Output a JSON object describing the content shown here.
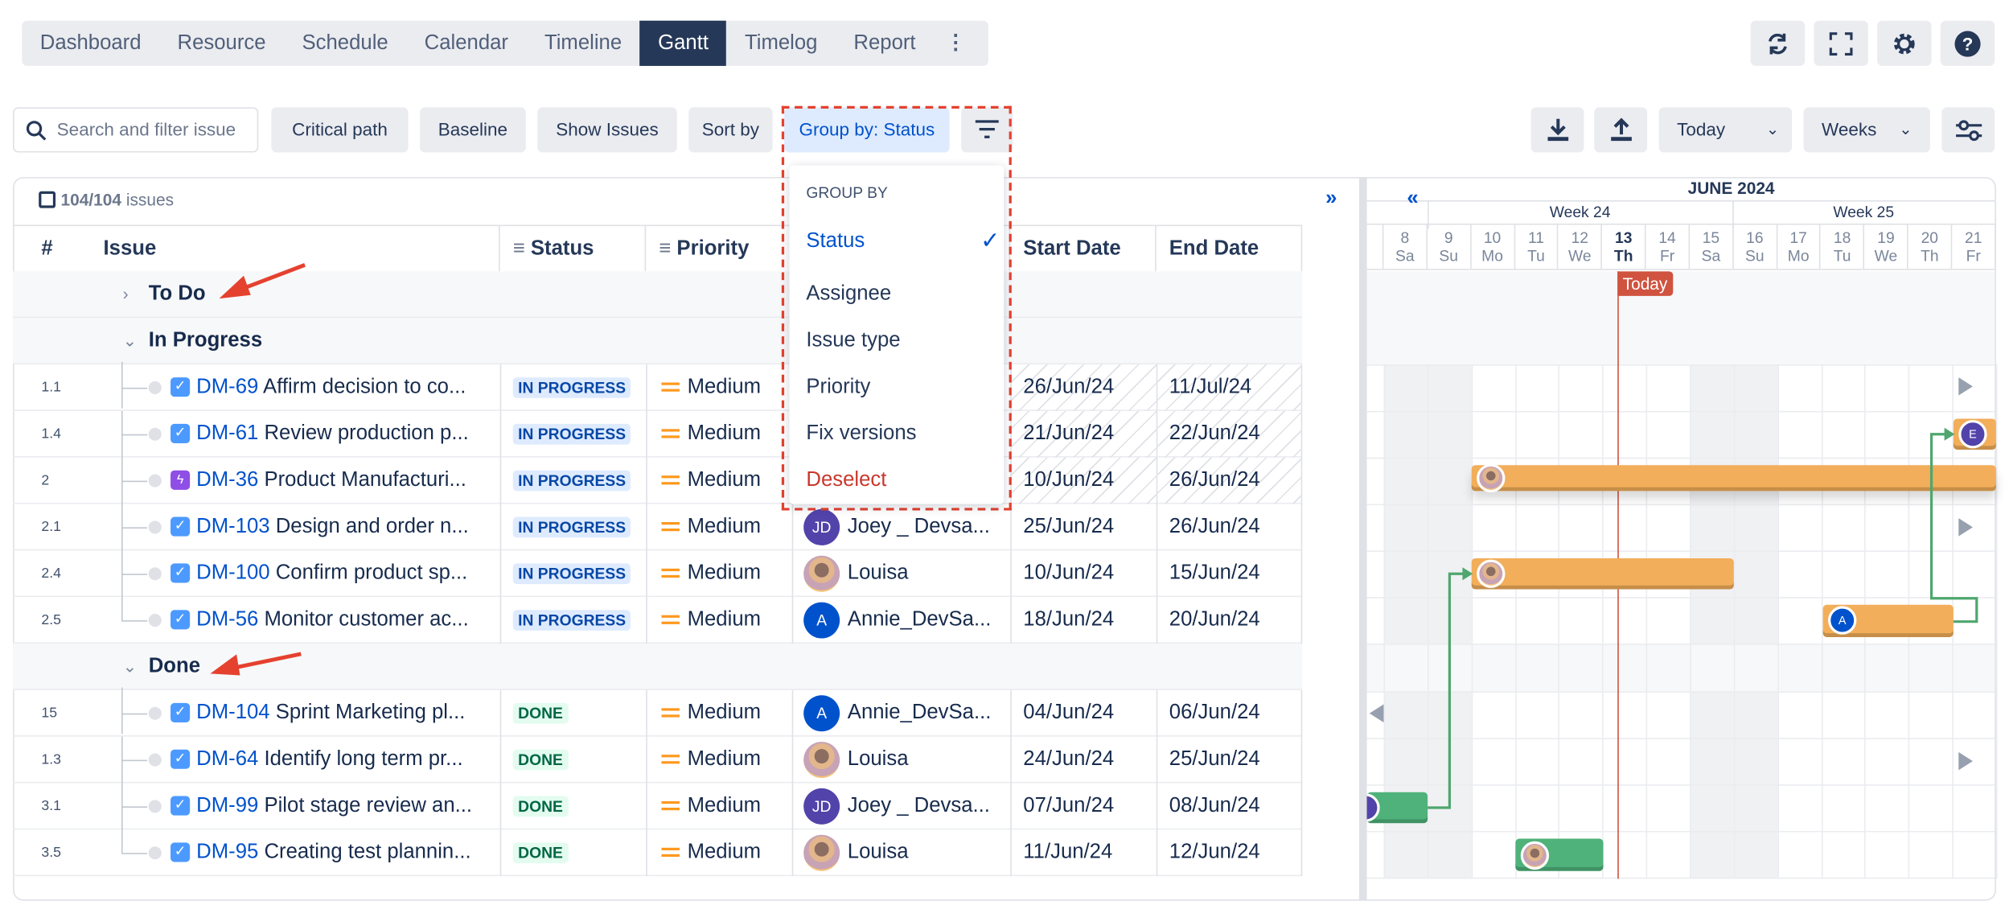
{
  "nav": {
    "tabs": [
      "Dashboard",
      "Resource",
      "Schedule",
      "Calendar",
      "Timeline",
      "Gantt",
      "Timelog",
      "Report"
    ],
    "active": "Gantt",
    "more": "⋮"
  },
  "top_icons": [
    "refresh-icon",
    "fullscreen-icon",
    "settings-icon",
    "help-icon"
  ],
  "toolbar": {
    "search_placeholder": "Search and filter issue",
    "critical_path": "Critical path",
    "baseline": "Baseline",
    "show_issues": "Show Issues",
    "sort_by": "Sort by",
    "group_by": "Group by: Status",
    "today": "Today",
    "weeks": "Weeks"
  },
  "group_menu": {
    "heading": "GROUP BY",
    "items": [
      "Status",
      "Assignee",
      "Issue type",
      "Priority",
      "Fix versions"
    ],
    "selected": "Status",
    "deselect": "Deselect"
  },
  "table": {
    "count": "104/104",
    "count_suffix": "issues",
    "columns": {
      "num": "#",
      "issue": "Issue",
      "status": "Status",
      "priority": "Priority",
      "start": "Start Date",
      "end": "End Date"
    }
  },
  "groups": [
    {
      "name": "To Do",
      "expanded": false,
      "rows": []
    },
    {
      "name": "In Progress",
      "expanded": true,
      "rows": [
        {
          "num": "1.1",
          "key": "DM-69",
          "title": "Affirm decision to co...",
          "type": "task",
          "status": "IN PROGRESS",
          "priority": "Medium",
          "assignee": "",
          "avatar": "",
          "start": "26/Jun/24",
          "end": "11/Jul/24"
        },
        {
          "num": "1.4",
          "key": "DM-61",
          "title": "Review production p...",
          "type": "task",
          "status": "IN PROGRESS",
          "priority": "Medium",
          "assignee": "",
          "avatar": "",
          "start": "21/Jun/24",
          "end": "22/Jun/24"
        },
        {
          "num": "2",
          "key": "DM-36",
          "title": "Product Manufacturi...",
          "type": "epic",
          "status": "IN PROGRESS",
          "priority": "Medium",
          "assignee": "",
          "avatar": "",
          "start": "10/Jun/24",
          "end": "26/Jun/24"
        },
        {
          "num": "2.1",
          "key": "DM-103",
          "title": "Design and order n...",
          "type": "task",
          "status": "IN PROGRESS",
          "priority": "Medium",
          "assignee": "Joey _ Devsa...",
          "avatar": "JD",
          "start": "25/Jun/24",
          "end": "26/Jun/24"
        },
        {
          "num": "2.4",
          "key": "DM-100",
          "title": "Confirm product sp...",
          "type": "task",
          "status": "IN PROGRESS",
          "priority": "Medium",
          "assignee": "Louisa",
          "avatar": "photo",
          "start": "10/Jun/24",
          "end": "15/Jun/24"
        },
        {
          "num": "2.5",
          "key": "DM-56",
          "title": "Monitor customer ac...",
          "type": "task",
          "status": "IN PROGRESS",
          "priority": "Medium",
          "assignee": "Annie_DevSa...",
          "avatar": "A",
          "start": "18/Jun/24",
          "end": "20/Jun/24"
        }
      ]
    },
    {
      "name": "Done",
      "expanded": true,
      "rows": [
        {
          "num": "15",
          "key": "DM-104",
          "title": "Sprint Marketing pl...",
          "type": "task",
          "status": "DONE",
          "priority": "Medium",
          "assignee": "Annie_DevSa...",
          "avatar": "A",
          "start": "04/Jun/24",
          "end": "06/Jun/24"
        },
        {
          "num": "1.3",
          "key": "DM-64",
          "title": "Identify long term pr...",
          "type": "task",
          "status": "DONE",
          "priority": "Medium",
          "assignee": "Louisa",
          "avatar": "photo",
          "start": "24/Jun/24",
          "end": "25/Jun/24"
        },
        {
          "num": "3.1",
          "key": "DM-99",
          "title": "Pilot stage review an...",
          "type": "task",
          "status": "DONE",
          "priority": "Medium",
          "assignee": "Joey _ Devsa...",
          "avatar": "JD",
          "start": "07/Jun/24",
          "end": "08/Jun/24"
        },
        {
          "num": "3.5",
          "key": "DM-95",
          "title": "Creating test plannin...",
          "type": "task",
          "status": "DONE",
          "priority": "Medium",
          "assignee": "Louisa",
          "avatar": "photo",
          "start": "11/Jun/24",
          "end": "12/Jun/24"
        }
      ]
    }
  ],
  "gantt": {
    "month": "JUNE 2024",
    "weeks": [
      "Week 24",
      "Week 25"
    ],
    "today_label": "Today",
    "days": [
      {
        "d": "8",
        "w": "Sa"
      },
      {
        "d": "9",
        "w": "Su"
      },
      {
        "d": "10",
        "w": "Mo"
      },
      {
        "d": "11",
        "w": "Tu"
      },
      {
        "d": "12",
        "w": "We"
      },
      {
        "d": "13",
        "w": "Th"
      },
      {
        "d": "14",
        "w": "Fr"
      },
      {
        "d": "15",
        "w": "Sa"
      },
      {
        "d": "16",
        "w": "Su"
      },
      {
        "d": "17",
        "w": "Mo"
      },
      {
        "d": "18",
        "w": "Tu"
      },
      {
        "d": "19",
        "w": "We"
      },
      {
        "d": "20",
        "w": "Th"
      },
      {
        "d": "21",
        "w": "Fr"
      }
    ],
    "today": "13",
    "bar_avatar_e": "E",
    "bar_avatar_a": "A"
  },
  "colors": {
    "in_progress_bar": "#f2ae5a",
    "done_bar": "#4fb27a",
    "accent": "#0052cc",
    "today": "#d0533f",
    "done_badge": "#006644",
    "in_progress_badge": "#0747a6"
  }
}
